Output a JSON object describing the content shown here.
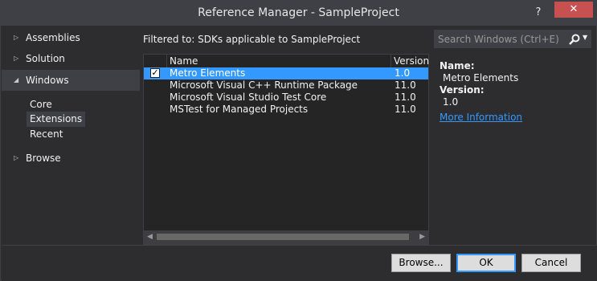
{
  "window": {
    "title": "Reference Manager - SampleProject",
    "help_label": "?",
    "close_label": "✕"
  },
  "nav": {
    "sections": [
      {
        "label": "Assemblies",
        "expanded": false
      },
      {
        "label": "Solution",
        "expanded": false
      },
      {
        "label": "Windows",
        "expanded": true
      },
      {
        "label": "Browse",
        "expanded": false
      }
    ],
    "windows_children": [
      "Core",
      "Extensions",
      "Recent"
    ],
    "selected_child": "Extensions"
  },
  "filter": {
    "text": "Filtered to: SDKs applicable to SampleProject"
  },
  "search": {
    "placeholder": "Search Windows (Ctrl+E)"
  },
  "table": {
    "columns": [
      "Name",
      "Version"
    ],
    "rows": [
      {
        "name": "Metro Elements",
        "version": "1.0",
        "checked": true,
        "selected": true
      },
      {
        "name": "Microsoft Visual C++ Runtime Package",
        "version": "11.0",
        "checked": false,
        "selected": false
      },
      {
        "name": "Microsoft Visual Studio Test Core",
        "version": "11.0",
        "checked": false,
        "selected": false
      },
      {
        "name": "MSTest for Managed Projects",
        "version": "11.0",
        "checked": false,
        "selected": false
      }
    ]
  },
  "details": {
    "name_key": "Name:",
    "name_value": "Metro Elements",
    "version_key": "Version:",
    "version_value": "1.0",
    "more_link": "More Information"
  },
  "buttons": {
    "browse": "Browse...",
    "ok": "OK",
    "cancel": "Cancel"
  },
  "colors": {
    "accent": "#3399ff",
    "close": "#c75050",
    "background": "#2d2d30"
  }
}
